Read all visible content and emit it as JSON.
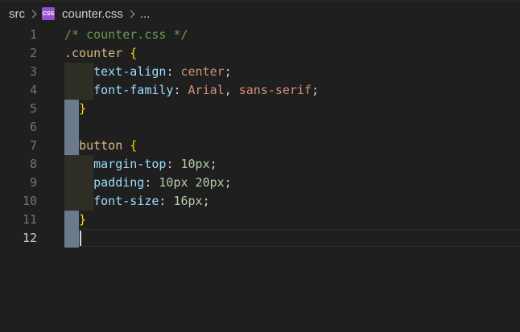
{
  "breadcrumb": {
    "folder": "src",
    "file_icon": "css-file-icon",
    "file_icon_text": "CSS",
    "file": "counter.css",
    "more": "..."
  },
  "editor": {
    "active_line": 12,
    "lines": [
      {
        "num": "1",
        "tokens": [
          {
            "t": "/* counter.css */",
            "k": "comment"
          }
        ]
      },
      {
        "num": "2",
        "tokens": [
          {
            "t": ".counter",
            "k": "selector"
          },
          {
            "t": " ",
            "k": "punct"
          },
          {
            "t": "{",
            "k": "brace"
          }
        ]
      },
      {
        "num": "3",
        "tokens": [
          {
            "t": "    ",
            "k": "punct"
          },
          {
            "t": "text-align",
            "k": "prop"
          },
          {
            "t": ": ",
            "k": "punct"
          },
          {
            "t": "center",
            "k": "value"
          },
          {
            "t": ";",
            "k": "punct"
          }
        ]
      },
      {
        "num": "4",
        "tokens": [
          {
            "t": "    ",
            "k": "punct"
          },
          {
            "t": "font-family",
            "k": "prop"
          },
          {
            "t": ": ",
            "k": "punct"
          },
          {
            "t": "Arial",
            "k": "value"
          },
          {
            "t": ", ",
            "k": "punct"
          },
          {
            "t": "sans-serif",
            "k": "value"
          },
          {
            "t": ";",
            "k": "punct"
          }
        ]
      },
      {
        "num": "5",
        "tokens": [
          {
            "t": "  ",
            "k": "punct"
          },
          {
            "t": "}",
            "k": "brace"
          }
        ]
      },
      {
        "num": "6",
        "tokens": []
      },
      {
        "num": "7",
        "tokens": [
          {
            "t": "  ",
            "k": "punct"
          },
          {
            "t": "button",
            "k": "selector"
          },
          {
            "t": " ",
            "k": "punct"
          },
          {
            "t": "{",
            "k": "brace"
          }
        ]
      },
      {
        "num": "8",
        "tokens": [
          {
            "t": "    ",
            "k": "punct"
          },
          {
            "t": "margin-top",
            "k": "prop"
          },
          {
            "t": ": ",
            "k": "punct"
          },
          {
            "t": "10px",
            "k": "num"
          },
          {
            "t": ";",
            "k": "punct"
          }
        ]
      },
      {
        "num": "9",
        "tokens": [
          {
            "t": "    ",
            "k": "punct"
          },
          {
            "t": "padding",
            "k": "prop"
          },
          {
            "t": ": ",
            "k": "punct"
          },
          {
            "t": "10px 20px",
            "k": "num"
          },
          {
            "t": ";",
            "k": "punct"
          }
        ]
      },
      {
        "num": "10",
        "tokens": [
          {
            "t": "    ",
            "k": "punct"
          },
          {
            "t": "font-size",
            "k": "prop"
          },
          {
            "t": ": ",
            "k": "punct"
          },
          {
            "t": "16px",
            "k": "num"
          },
          {
            "t": ";",
            "k": "punct"
          }
        ]
      },
      {
        "num": "11",
        "tokens": [
          {
            "t": "  ",
            "k": "punct"
          },
          {
            "t": "}",
            "k": "brace"
          }
        ]
      },
      {
        "num": "12",
        "tokens": []
      }
    ],
    "indent_guides": {
      "dark1": [
        3,
        4,
        8,
        9,
        10
      ],
      "dark2": [
        3,
        4,
        8,
        9,
        10
      ],
      "blue1": [
        5,
        6,
        7,
        11,
        12
      ]
    }
  },
  "colors": {
    "background": "#1f1f1f",
    "comment": "#6a9955",
    "selector": "#d7ba7d",
    "brace": "#ffd700",
    "property": "#9cdcfe",
    "string_value": "#ce9178",
    "number_value": "#b5cea8",
    "indent_dark": "#2e2e24",
    "indent_blue": "#6b7a8c"
  }
}
